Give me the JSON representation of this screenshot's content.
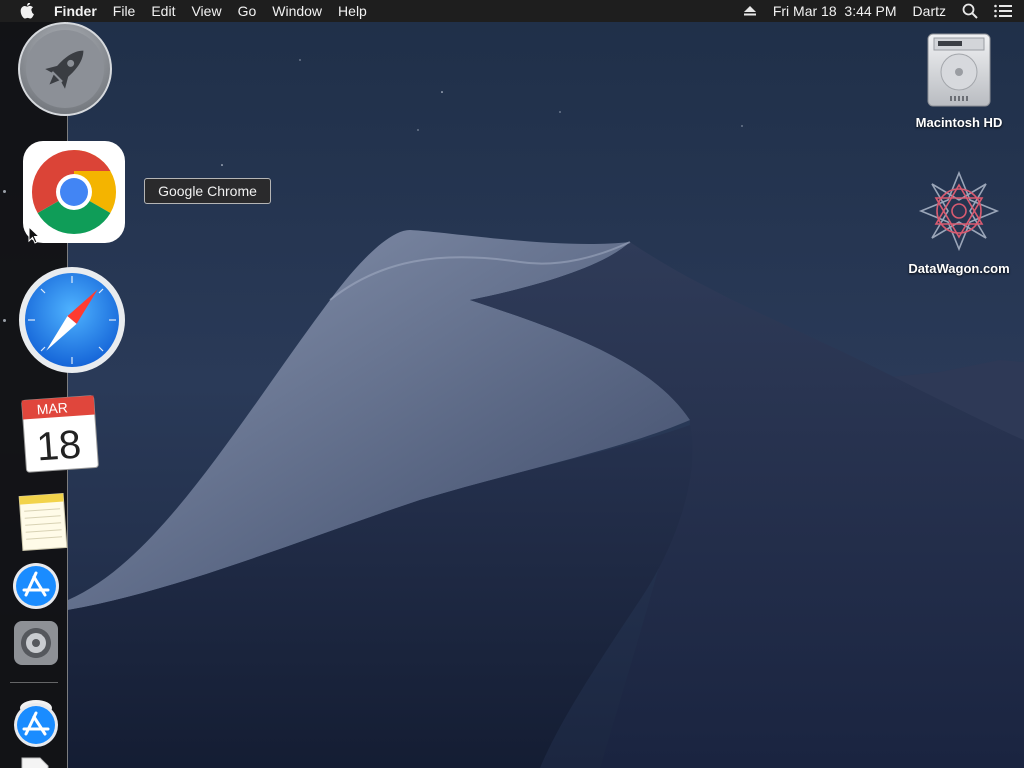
{
  "menubar": {
    "app_name": "Finder",
    "items": [
      "File",
      "Edit",
      "View",
      "Go",
      "Window",
      "Help"
    ],
    "datetime": "Fri Mar 18  3:44 PM",
    "user": "Dartz",
    "icons": [
      "apple-icon",
      "eject-icon",
      "spotlight-search-icon",
      "notification-center-icon"
    ]
  },
  "dock": {
    "items": [
      {
        "name": "Launchpad",
        "icon": "launchpad-rocket-icon"
      },
      {
        "name": "Google Chrome",
        "icon": "chrome-icon"
      },
      {
        "name": "Safari",
        "icon": "safari-compass-icon"
      },
      {
        "name": "Calendar",
        "icon": "calendar-icon",
        "month": "MAR",
        "day": "18"
      },
      {
        "name": "Notes",
        "icon": "notes-icon"
      },
      {
        "name": "App Store",
        "icon": "app-store-icon"
      },
      {
        "name": "System Preferences",
        "icon": "gear-icon"
      },
      {
        "name": "App Store Download",
        "icon": "app-store-icon"
      },
      {
        "name": "Document",
        "icon": "document-icon"
      }
    ],
    "tooltip": "Google Chrome"
  },
  "desktop": {
    "icons": [
      {
        "label": "Macintosh HD",
        "icon": "hard-drive-icon"
      },
      {
        "label": "DataWagon.com",
        "icon": "datawagon-logo-icon"
      }
    ]
  },
  "colors": {
    "menubar_bg": "#1e1e1e",
    "dock_bg": "#121214",
    "chrome_red": "#db4437",
    "chrome_green": "#0f9d58",
    "chrome_yellow": "#f4b400",
    "chrome_blue": "#4285f4",
    "safari_blue": "#1a8cff"
  }
}
